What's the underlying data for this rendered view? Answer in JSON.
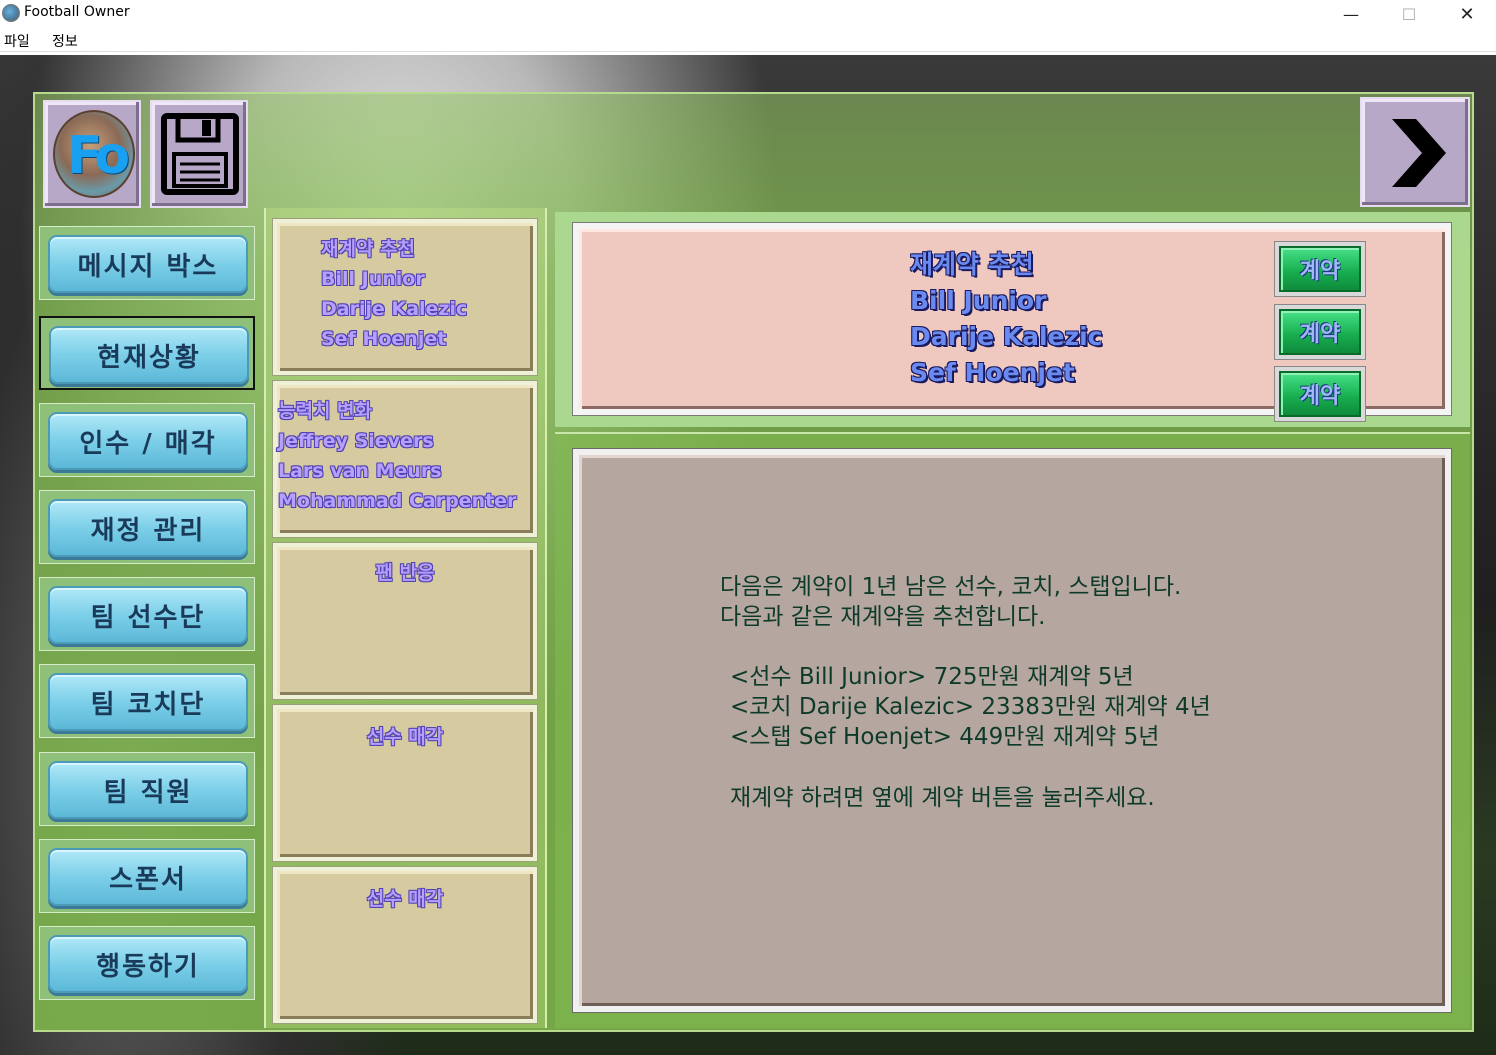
{
  "window": {
    "title": "Football Owner",
    "min_glyph": "—",
    "max_glyph": "☐",
    "close_glyph": "✕"
  },
  "menu": {
    "file": "파일",
    "info": "정보"
  },
  "header": {
    "logo_text": "Fo",
    "save_icon": "floppy-disk-icon",
    "next_icon": "chevron-right-icon"
  },
  "sidebar": {
    "items": [
      {
        "label": "메시지 박스"
      },
      {
        "label": "현재상황",
        "active": true
      },
      {
        "label": "인수 / 매각"
      },
      {
        "label": "재정 관리"
      },
      {
        "label": "팀 선수단"
      },
      {
        "label": "팀 코치단"
      },
      {
        "label": "팀 직원"
      },
      {
        "label": "스폰서"
      },
      {
        "label": "행동하기"
      }
    ]
  },
  "middle": {
    "cards": [
      {
        "lines": [
          "재계약 추천",
          "Bill Junior",
          "Darije Kalezic",
          "Sef Hoenjet"
        ]
      },
      {
        "lines": [
          "능력치 변화",
          "Jeffrey Sievers",
          "Lars van Meurs",
          "Mohammad Carpenter"
        ]
      },
      {
        "lines": [
          "팬 반응"
        ]
      },
      {
        "lines": [
          "선수 매각"
        ]
      },
      {
        "lines": [
          "선수 매각"
        ]
      }
    ]
  },
  "contract": {
    "lines": [
      "재계약 추천",
      "Bill Junior",
      "Darije Kalezic",
      "Sef Hoenjet"
    ],
    "button_label": "계약"
  },
  "message": {
    "lines": [
      "다음은 계약이 1년 남은 선수, 코치, 스탭입니다.",
      "다음과 같은 재계약을 추천합니다.",
      "<선수 Bill Junior> 725만원 재계약 5년",
      "<코치 Darije Kalezic> 23383만원 재계약 4년",
      "<스탭 Sef Hoenjet> 449만원 재계약 5년",
      "재계약 하려면 옆에 계약 버튼을 눌러주세요."
    ]
  },
  "colors": {
    "frame_green": "#7db44b",
    "contract_bg": "#efc8c0",
    "message_bg": "#b6a6a0",
    "sidebar_button": "#7ccfe8"
  }
}
